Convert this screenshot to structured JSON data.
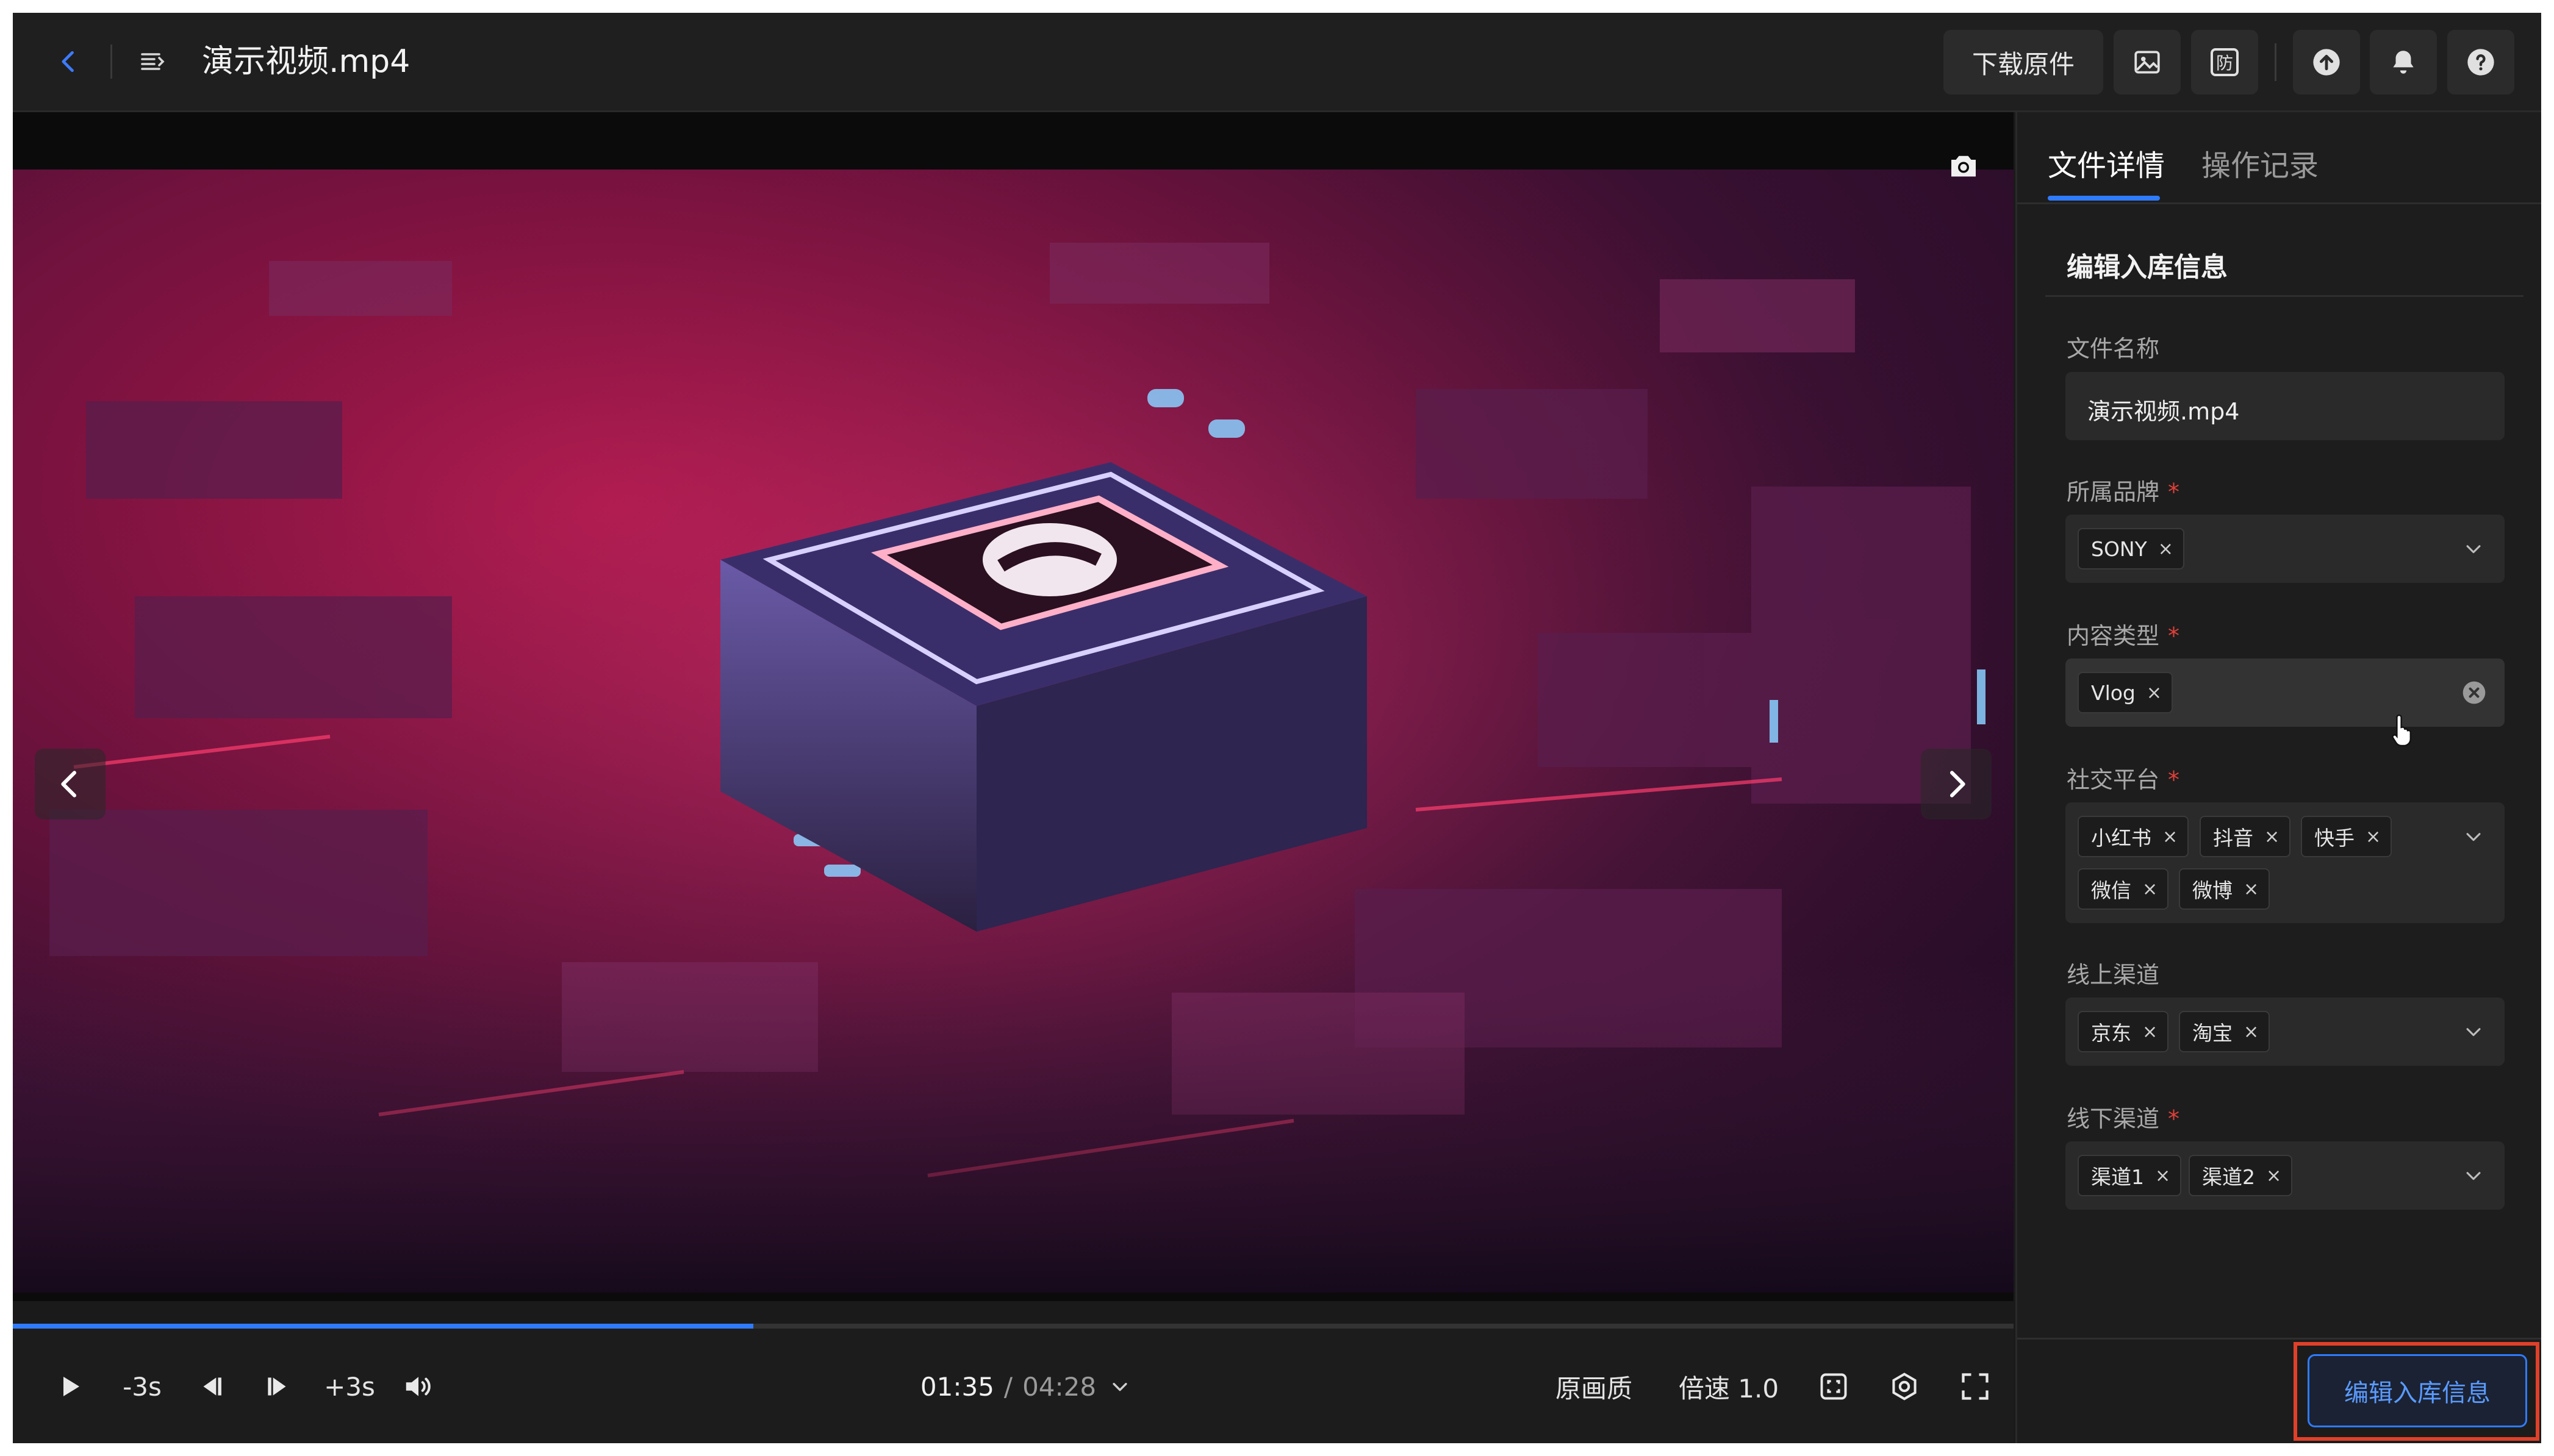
{
  "header": {
    "file_title": "演示视频.mp4",
    "download_label": "下载原件",
    "icons": [
      "back-icon",
      "menu-icon",
      "image-icon",
      "protect-icon",
      "upload-icon",
      "bell-icon",
      "help-icon"
    ],
    "protect_glyph": "防"
  },
  "player": {
    "progress_fraction": 0.37,
    "skip_back_label": "-3s",
    "skip_forward_label": "+3s",
    "time_current": "01:35",
    "time_separator": "/",
    "time_total": "04:28",
    "quality_label": "原画质",
    "speed_label": "倍速 1.0"
  },
  "panel": {
    "tabs": [
      {
        "label": "文件详情",
        "active": true
      },
      {
        "label": "操作记录",
        "active": false
      }
    ],
    "section_title": "编辑入库信息",
    "fields": {
      "file_name": {
        "label": "文件名称",
        "value": "演示视频.mp4"
      },
      "brand": {
        "label": "所属品牌",
        "required_mark": "*",
        "tags": [
          "SONY"
        ]
      },
      "content_type": {
        "label": "内容类型",
        "required_mark": "*",
        "tags": [
          "Vlog"
        ]
      },
      "social": {
        "label": "社交平台",
        "required_mark": "*",
        "tags": [
          "小红书",
          "抖音",
          "快手",
          "微信",
          "微博"
        ]
      },
      "online": {
        "label": "线上渠道",
        "tags": [
          "京东",
          "淘宝"
        ]
      },
      "offline": {
        "label": "线下渠道",
        "required_mark": "*",
        "tags": [
          "渠道1",
          "渠道2"
        ]
      }
    },
    "tag_remove_glyph": "×",
    "edit_button_label": "编辑入库信息"
  },
  "colors": {
    "accent": "#2f7bff",
    "highlight_border": "#e0402a",
    "required": "#e0403a"
  }
}
